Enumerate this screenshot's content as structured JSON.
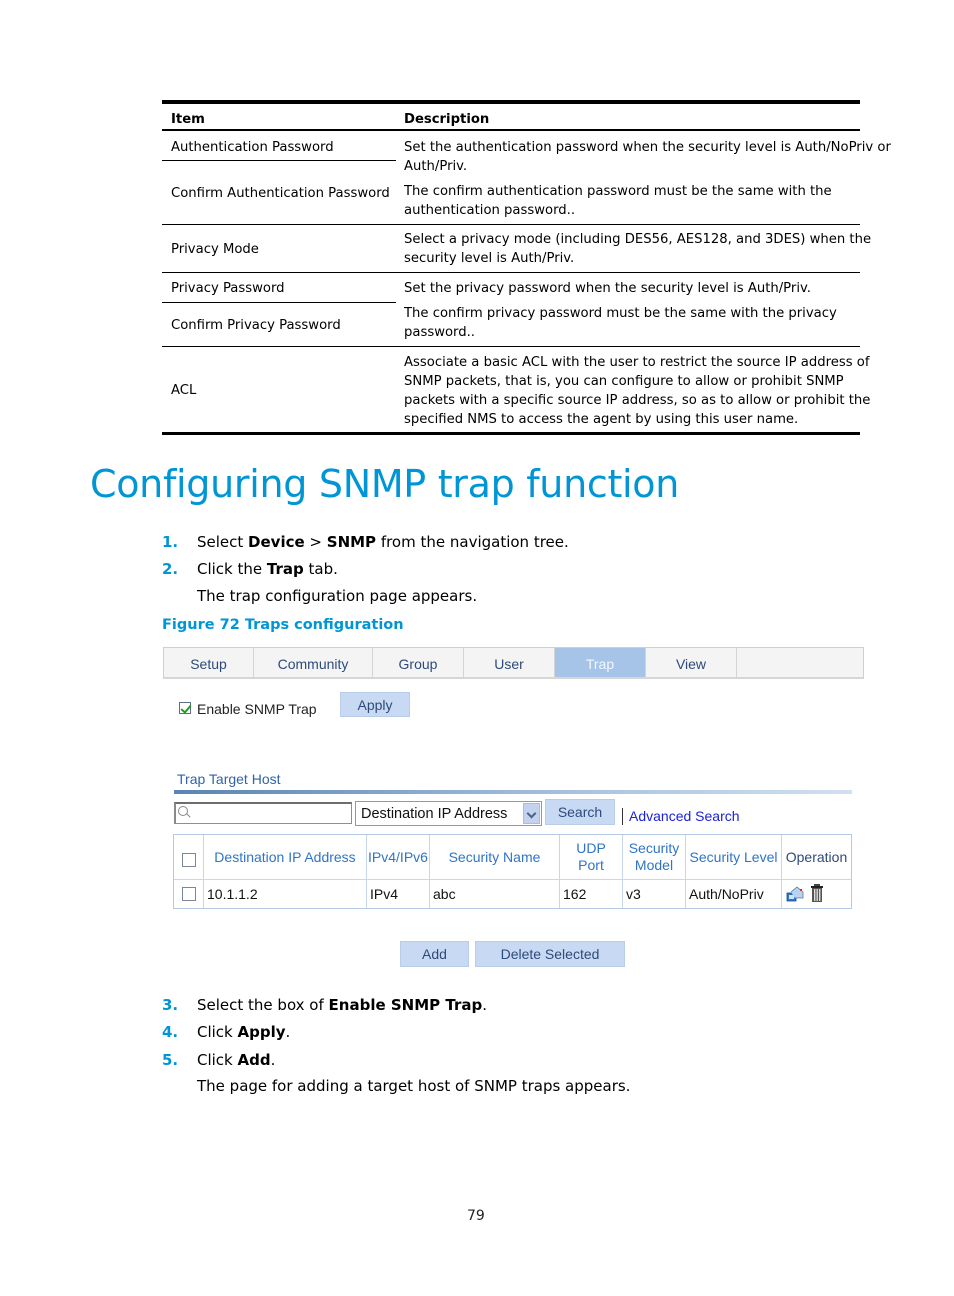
{
  "description_table": {
    "headers": [
      "Item",
      "Description"
    ],
    "rows": [
      {
        "item": "Authentication Password",
        "description_lines": [
          "Set the authentication password when the security level is Auth/NoPriv or",
          "Auth/Priv."
        ]
      },
      {
        "item": "Confirm Authentication Password",
        "description_lines": [
          "The confirm authentication password must be the same with the",
          "authentication password.."
        ]
      },
      {
        "item": "Privacy Mode",
        "description_lines": [
          "Select a privacy mode (including DES56, AES128, and 3DES) when the",
          "security level is Auth/Priv."
        ]
      },
      {
        "item": "Privacy Password",
        "description_lines": [
          "Set the privacy password when the security level is Auth/Priv."
        ]
      },
      {
        "item": "Confirm Privacy Password",
        "description_lines": [
          "The confirm privacy password must be the same with the privacy",
          "password.."
        ]
      },
      {
        "item": "ACL",
        "description_lines": [
          "Associate a basic ACL with the user to restrict the source IP address of",
          "SNMP packets, that is, you can configure to allow or prohibit SNMP",
          "packets with a specific source IP address, so as to allow or prohibit the",
          "specified NMS to access the agent by using this user name."
        ]
      }
    ]
  },
  "section_heading": "Configuring SNMP trap function",
  "steps_before": [
    {
      "num": "1.",
      "pre": "Select ",
      "b1": "Device",
      "mid": " > ",
      "b2": "SNMP",
      "post": " from the navigation tree."
    },
    {
      "num": "2.",
      "pre": "Click the ",
      "b1": "Trap",
      "post": " tab."
    }
  ],
  "step2_result": "The trap configuration page appears.",
  "figure_caption": "Figure 72 Traps configuration",
  "screenshot": {
    "tabs": [
      {
        "label": "Setup",
        "active": false
      },
      {
        "label": "Community",
        "active": false
      },
      {
        "label": "Group",
        "active": false
      },
      {
        "label": "User",
        "active": false
      },
      {
        "label": "Trap",
        "active": true
      },
      {
        "label": "View",
        "active": false
      }
    ],
    "enable_trap": {
      "label": "Enable SNMP Trap",
      "checked": true
    },
    "apply_label": "Apply",
    "section_title": "Trap Target Host",
    "search": {
      "value": "",
      "field_select": "Destination IP Address",
      "search_label": "Search",
      "advanced_label": "Advanced Search"
    },
    "grid": {
      "columns": [
        "Destination IP Address",
        "IPv4/IPv6",
        "Security Name",
        "UDP Port",
        "Security Model",
        "Security Level",
        "Operation"
      ],
      "rows": [
        {
          "dest_ip": "10.1.1.2",
          "ip_version": "IPv4",
          "security_name": "abc",
          "udp_port": "162",
          "security_model": "v3",
          "security_level": "Auth/NoPriv",
          "operations": [
            "edit-icon",
            "delete-icon"
          ]
        }
      ]
    },
    "add_label": "Add",
    "delete_selected_label": "Delete Selected",
    "colors": {
      "active_tab": "#a6c4e8",
      "button": "#c8daf3",
      "header_text": "#2f74c9",
      "link": "#1a22d8"
    }
  },
  "steps_after": [
    {
      "num": "3.",
      "pre": "Select the box of ",
      "b1": "Enable SNMP Trap",
      "post": "."
    },
    {
      "num": "4.",
      "pre": "Click ",
      "b1": "Apply",
      "post": "."
    },
    {
      "num": "5.",
      "pre": "Click ",
      "b1": "Add",
      "post": "."
    }
  ],
  "step5_result": "The page for adding a target host of SNMP traps appears.",
  "page_number": "79",
  "colors": {
    "accent": "#0096d6"
  }
}
